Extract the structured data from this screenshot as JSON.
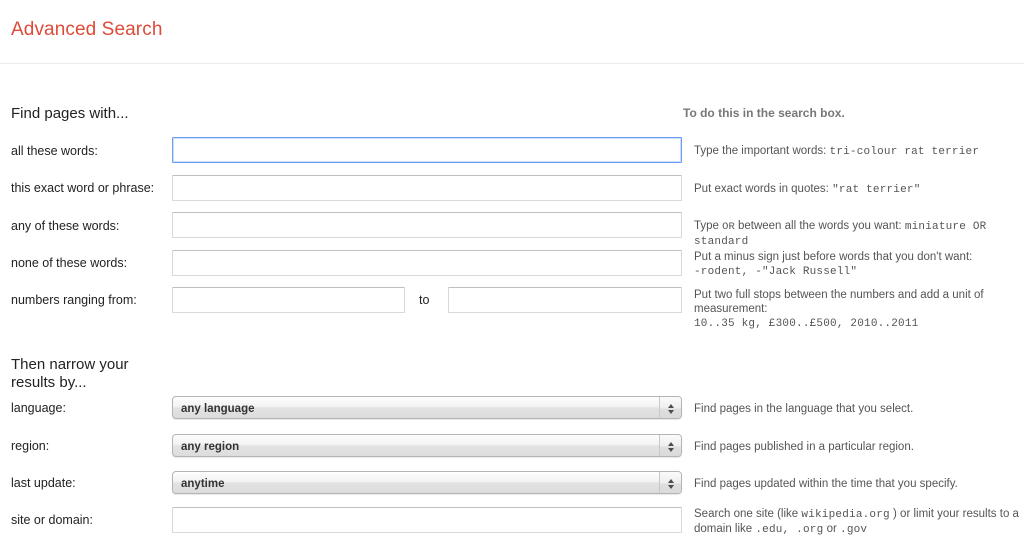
{
  "header": {
    "title": "Advanced Search",
    "title_color": "#dd4b39"
  },
  "columns": {
    "left_heading": "Find pages with...",
    "right_heading": "To do this in the search box."
  },
  "find_pages_with": {
    "rows": [
      {
        "label": "all these words:",
        "type": "text",
        "value": "",
        "focused": true,
        "help_prefix": "Type the important words:",
        "help_mono": "tri-colour rat terrier",
        "help_suffix": ""
      },
      {
        "label": "this exact word or phrase:",
        "type": "text",
        "value": "",
        "focused": false,
        "help_prefix": "Put exact words in quotes:",
        "help_mono": "\"rat terrier\"",
        "help_suffix": ""
      },
      {
        "label": "any of these words:",
        "type": "text",
        "value": "",
        "focused": false,
        "help_prefix": "Type",
        "help_inline_mono": "OR",
        "help_mid": "between all the words you want:",
        "help_mono": "miniature OR standard",
        "help_suffix": ""
      },
      {
        "label": "none of these words:",
        "type": "text",
        "value": "",
        "focused": false,
        "help_prefix": "Put a minus sign just before words that you don't want:",
        "help_mono": "-rodent, -\"Jack Russell\"",
        "help_suffix": ""
      },
      {
        "label": "numbers ranging from:",
        "type": "range",
        "value_from": "",
        "value_to": "",
        "separator": "to",
        "focused": false,
        "help_prefix": "Put two full stops between the numbers and add a unit of measurement:",
        "help_mono": "10..35 kg, £300..£500, 2010..2011",
        "help_suffix": ""
      }
    ]
  },
  "narrow_results": {
    "heading": "Then narrow your results by...",
    "rows": [
      {
        "label": "language:",
        "type": "select",
        "value": "any language",
        "help_text": "Find pages in the language that you select."
      },
      {
        "label": "region:",
        "type": "select",
        "value": "any region",
        "help_text": "Find pages published in a particular region."
      },
      {
        "label": "last update:",
        "type": "select",
        "value": "anytime",
        "help_text": "Find pages updated within the time that you specify."
      },
      {
        "label": "site or domain:",
        "type": "text",
        "value": "",
        "help_prefix": "Search one site (like",
        "help_mono": "wikipedia.org",
        "help_mid": ") or limit your results to a domain like",
        "help_mono2": ".edu, .org",
        "help_mid2": "or",
        "help_mono3": ".gov"
      }
    ]
  }
}
